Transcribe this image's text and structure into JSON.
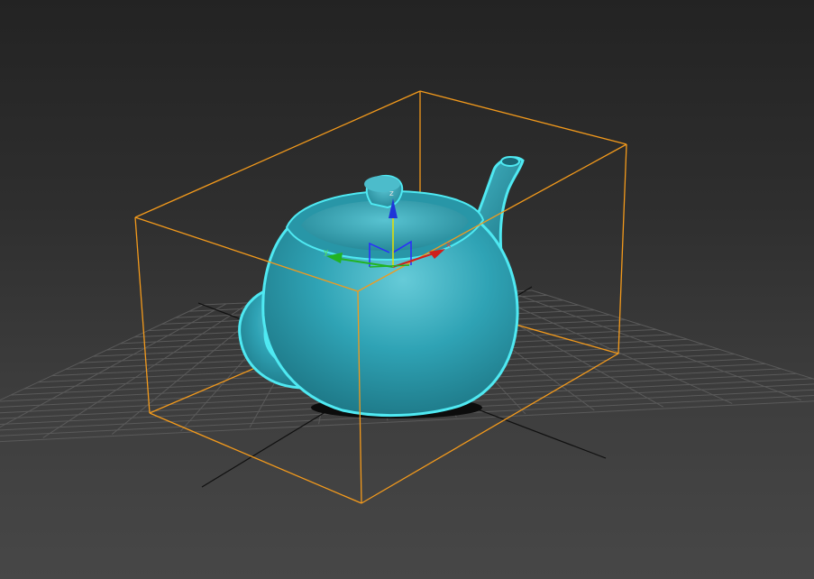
{
  "viewport": {
    "background_top": "#232323",
    "background_bottom": "#474747"
  },
  "object": {
    "name": "teapot",
    "color": "#2fa3b5",
    "outline_color": "#4fe9f2",
    "selected": true
  },
  "bounding_box": {
    "color": "#f39a1c"
  },
  "grid": {
    "line_color": "#5a5a5a",
    "axis_color": "#101010"
  },
  "gizmo": {
    "x_label": "x",
    "y_label": "y",
    "z_label": "z",
    "x_color": "#d0201c",
    "y_color": "#22b322",
    "z_color": "#1f35d8",
    "plane_color": "#2a2aff"
  }
}
